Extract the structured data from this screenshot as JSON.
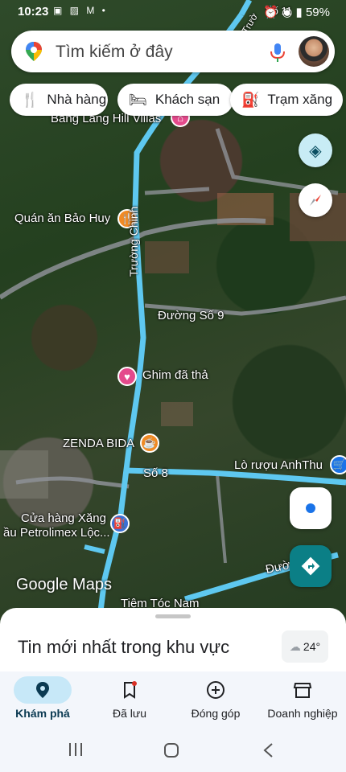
{
  "status_bar": {
    "time": "10:23",
    "battery": "59%"
  },
  "search": {
    "placeholder": "Tìm kiếm ở đây"
  },
  "chips": [
    {
      "label": "Nhà hàng",
      "icon": "fork-knife-icon"
    },
    {
      "label": "Khách sạn",
      "icon": "bed-icon"
    },
    {
      "label": "Trạm xăng",
      "icon": "gas-station-icon"
    }
  ],
  "map_labels": {
    "bang_lang": "Bang Lang Hill Villas",
    "quan_an": "Quán ăn Bảo Huy",
    "truong_chinh": "Trường Chinh",
    "duong_so_9": "Đường Số 9",
    "ghim": "Ghim đã thả",
    "zenda": "ZENDA BIDA",
    "so_8": "Số 8",
    "lo_ruou": "Lò rượu AnhThu",
    "cua_hang_1": "Cửa hàng Xăng",
    "cua_hang_2": "ầu Petrolimex Lộc...",
    "tiem_toc": "Tiệm Tóc Nam",
    "duong_short": "Đườ",
    "so_11": "Số 11",
    "truong_short": "Trườ"
  },
  "google_maps": "Google Maps",
  "sheet": {
    "title": "Tin mới nhất trong khu vực",
    "temperature": "24°"
  },
  "nav": [
    {
      "label": "Khám phá",
      "icon": "explore-pin-icon"
    },
    {
      "label": "Đã lưu",
      "icon": "bookmark-icon"
    },
    {
      "label": "Đóng góp",
      "icon": "add-circle-icon"
    },
    {
      "label": "Doanh nghiệp",
      "icon": "store-icon"
    }
  ],
  "colors": {
    "road": "#5ec8f0",
    "route_blue": "#4aa8e0",
    "accent": "#1a73e8",
    "teal": "#0b7f86"
  }
}
